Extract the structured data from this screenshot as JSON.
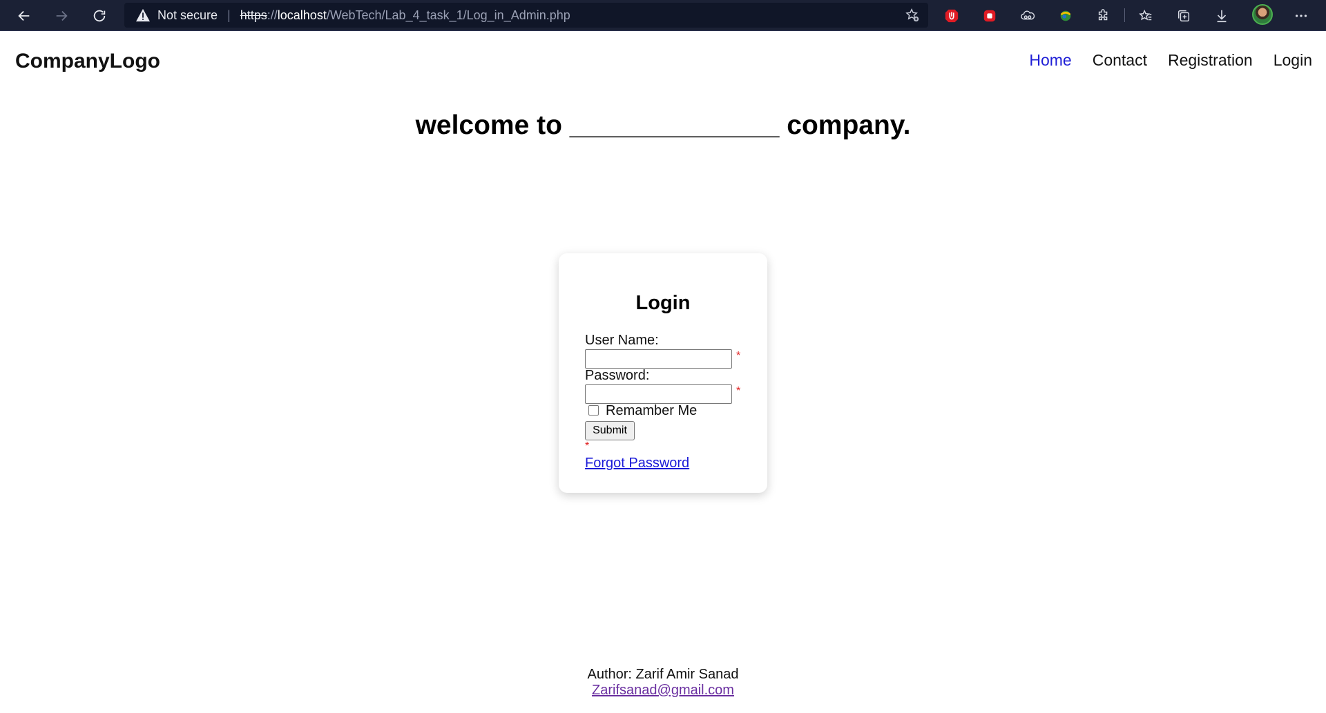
{
  "browser": {
    "security_label": "Not secure",
    "url_scheme": "https",
    "url_host": "localhost",
    "url_path": "/WebTech/Lab_4_task_1/Log_in_Admin.php",
    "url_separator": "://"
  },
  "header": {
    "brand": "CompanyLogo",
    "nav": [
      "Home",
      "Contact",
      "Registration",
      "Login"
    ],
    "active_nav": "Home"
  },
  "welcome": "welcome to ______________ company.",
  "login": {
    "title": "Login",
    "username_label": "User Name:",
    "username_value": "",
    "password_label": "Password:",
    "password_value": "",
    "required_marker": "*",
    "remember_label": "Remamber Me",
    "remember_checked": false,
    "submit_label": "Submit",
    "forgot_label": "Forgot Password"
  },
  "footer": {
    "author": "Author: Zarif Amir Sanad",
    "email": "Zarifsanad@gmail.com"
  },
  "colors": {
    "browser_bg": "#1b2135",
    "address_bg": "#101628",
    "nav_active": "#1f1fd6",
    "required": "#e02020",
    "link": "#1a1ad8",
    "visited_link": "#6a2fa0"
  }
}
